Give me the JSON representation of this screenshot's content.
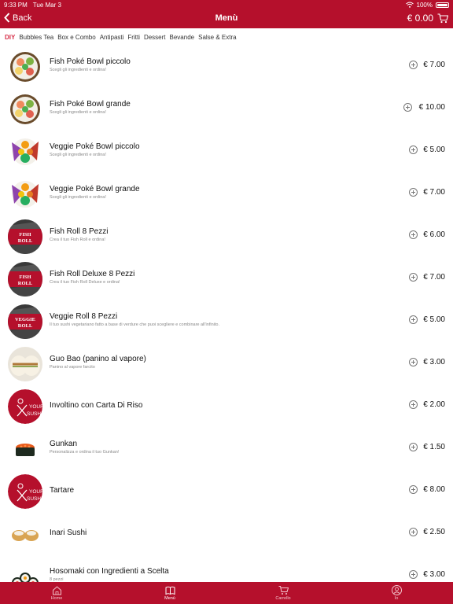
{
  "status": {
    "time": "9:33 PM",
    "date": "Tue Mar 3",
    "battery": "100%"
  },
  "nav": {
    "back_label": "Back",
    "title": "Menù",
    "cart_total": "€ 0.00"
  },
  "categories": [
    {
      "label": "DIY",
      "active": true
    },
    {
      "label": "Bubbles Tea"
    },
    {
      "label": "Box e Combo"
    },
    {
      "label": "Antipasti"
    },
    {
      "label": "Fritti"
    },
    {
      "label": "Dessert"
    },
    {
      "label": "Bevande"
    },
    {
      "label": "Salse & Extra"
    }
  ],
  "items": [
    {
      "name": "Fish Poké Bowl piccolo",
      "desc": "Scegli gli ingredienti e ordina!",
      "price": "€ 7.00",
      "image": "poke-bowl"
    },
    {
      "name": "Fish Poké Bowl grande",
      "desc": "Scegli gli ingredienti e ordina!",
      "price": "€ 10.00",
      "image": "poke-bowl"
    },
    {
      "name": "Veggie Poké Bowl piccolo",
      "desc": "Scegli gli ingredienti e ordina!",
      "price": "€ 5.00",
      "image": "veggie-bowl"
    },
    {
      "name": "Veggie Poké Bowl grande",
      "desc": "Scegli gli ingredienti e ordina!",
      "price": "€ 7.00",
      "image": "veggie-bowl"
    },
    {
      "name": "Fish Roll 8 Pezzi",
      "desc": "Crea il tuo Fish Roll e ordina!",
      "price": "€ 6.00",
      "image": "roll-badge",
      "badge": "FISH ROLL"
    },
    {
      "name": "Fish Roll Deluxe 8 Pezzi",
      "desc": "Crea il tuo Fish Roll Deluxe e ordina!",
      "price": "€ 7.00",
      "image": "roll-badge",
      "badge": "FISH ROLL"
    },
    {
      "name": "Veggie Roll 8 Pezzi",
      "desc": "Il tuo sushi vegetariano fatto a base di verdure che puoi scegliere e combinare all'infinito.",
      "price": "€ 5.00",
      "image": "roll-badge",
      "badge": "VEGGIE ROLL"
    },
    {
      "name": "Guo Bao (panino al vapore)",
      "desc": "Panino al vapore farcito",
      "price": "€ 3.00",
      "image": "guo-bao"
    },
    {
      "name": "Involtino con Carta Di Riso",
      "desc": "",
      "price": "€ 2.00",
      "image": "logo",
      "logo_text": "YOUR SUSHI"
    },
    {
      "name": "Gunkan",
      "desc": "Personalizza e ordina il tuo Gunkan!",
      "price": "€ 1.50",
      "image": "gunkan"
    },
    {
      "name": "Tartare",
      "desc": "",
      "price": "€ 8.00",
      "image": "logo",
      "logo_text": "YOUR SUSHI"
    },
    {
      "name": "Inari Sushi",
      "desc": "",
      "price": "€ 2.50",
      "image": "inari"
    },
    {
      "name": "Hosomaki con Ingredienti a Scelta",
      "desc": "8 pezzi",
      "price": "€ 3.00",
      "image": "hosomaki"
    }
  ],
  "tabs": [
    {
      "label": "Home",
      "icon": "home-icon"
    },
    {
      "label": "Menù",
      "icon": "book-icon",
      "active": true
    },
    {
      "label": "Carrello",
      "icon": "cart-icon"
    },
    {
      "label": "Io",
      "icon": "user-icon"
    }
  ],
  "colors": {
    "brand": "#b5102c",
    "active_category": "#d72f49"
  }
}
